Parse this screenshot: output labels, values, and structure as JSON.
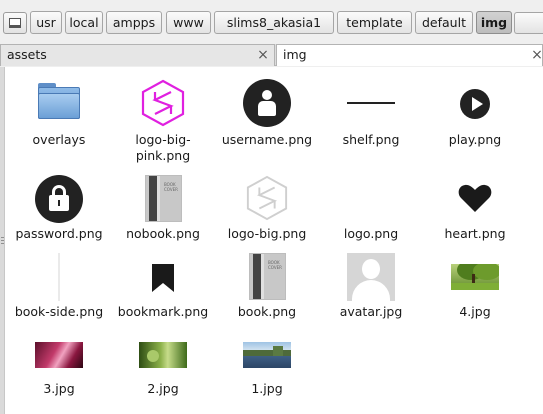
{
  "breadcrumb": {
    "segments": [
      {
        "label": "usr"
      },
      {
        "label": "local"
      },
      {
        "label": "ampps"
      },
      {
        "label": "www"
      },
      {
        "label": "slims8_akasia1"
      },
      {
        "label": "template"
      },
      {
        "label": "default"
      },
      {
        "label": "img",
        "active": true
      }
    ]
  },
  "tabs": [
    {
      "label": "assets"
    },
    {
      "label": "img",
      "selected": true
    }
  ],
  "tab_close_glyph": "×",
  "files": [
    {
      "name": "overlays",
      "icon": "folder-icon"
    },
    {
      "name": "logo-big-\npink.png",
      "icon": "logo-pink-icon"
    },
    {
      "name": "username.png",
      "icon": "user-icon"
    },
    {
      "name": "shelf.png",
      "icon": "shelf-line-icon"
    },
    {
      "name": "play.png",
      "icon": "play-icon"
    },
    {
      "name": "password.png",
      "icon": "lock-icon"
    },
    {
      "name": "nobook.png",
      "icon": "book-cover-icon"
    },
    {
      "name": "logo-big.png",
      "icon": "logo-grey-icon"
    },
    {
      "name": "logo.png",
      "icon": "blank-icon"
    },
    {
      "name": "heart.png",
      "icon": "heart-icon"
    },
    {
      "name": "book-side.png",
      "icon": "book-side-icon"
    },
    {
      "name": "bookmark.png",
      "icon": "bookmark-icon"
    },
    {
      "name": "book.png",
      "icon": "book-cover-icon"
    },
    {
      "name": "avatar.jpg",
      "icon": "avatar-icon"
    },
    {
      "name": "4.jpg",
      "icon": "photo-tree-icon"
    },
    {
      "name": "3.jpg",
      "icon": "photo-canyon-icon"
    },
    {
      "name": "2.jpg",
      "icon": "photo-nature-icon"
    },
    {
      "name": "1.jpg",
      "icon": "photo-lake-icon"
    }
  ],
  "colors": {
    "accent_pink": "#e020e0",
    "icon_dark": "#222222",
    "folder_blue": "#6a9fd8"
  }
}
